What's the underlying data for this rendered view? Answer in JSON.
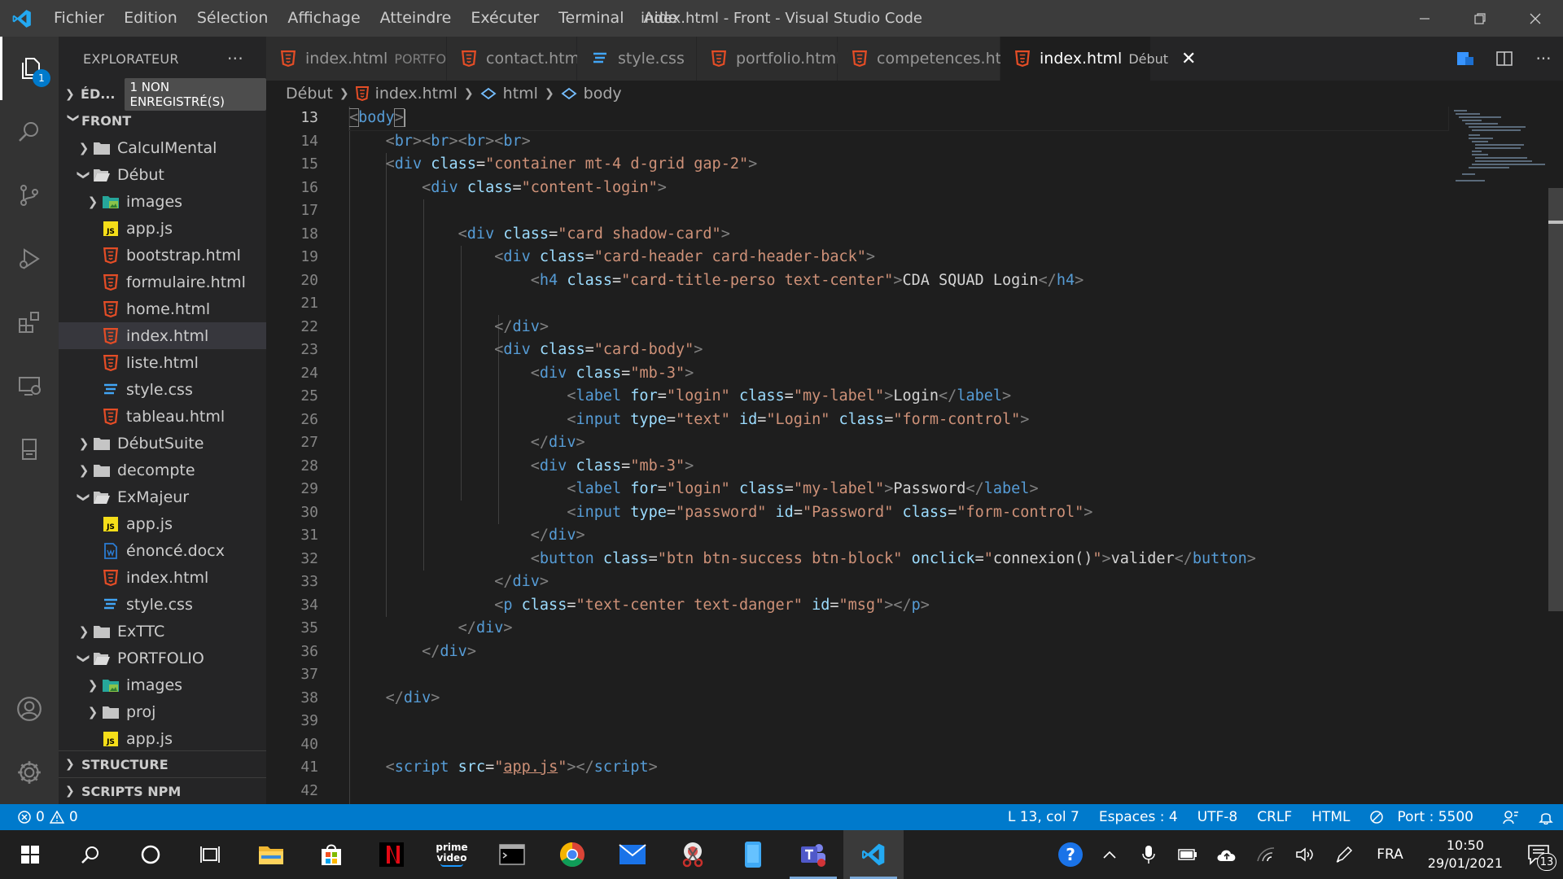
{
  "titlebar": {
    "menu": [
      "Fichier",
      "Edition",
      "Sélection",
      "Affichage",
      "Atteindre",
      "Exécuter",
      "Terminal",
      "Aide"
    ],
    "title": "index.html - Front - Visual Studio Code"
  },
  "activitybar": {
    "explorer_badge": "1"
  },
  "sidebar": {
    "header": "EXPLORATEUR",
    "more": "···",
    "open_editors": {
      "label": "ÉD...",
      "unsaved": "1 NON ENREGISTRÉ(S)"
    },
    "workspace": "FRONT",
    "tree": [
      {
        "label": "CalculMental",
        "type": "folder",
        "open": false,
        "depth": 0
      },
      {
        "label": "Début",
        "type": "folder",
        "open": true,
        "depth": 0
      },
      {
        "label": "images",
        "type": "img-folder",
        "open": false,
        "depth": 1
      },
      {
        "label": "app.js",
        "type": "js",
        "depth": 1
      },
      {
        "label": "bootstrap.html",
        "type": "html",
        "depth": 1
      },
      {
        "label": "formulaire.html",
        "type": "html",
        "depth": 1
      },
      {
        "label": "home.html",
        "type": "html",
        "depth": 1
      },
      {
        "label": "index.html",
        "type": "html",
        "depth": 1,
        "selected": true
      },
      {
        "label": "liste.html",
        "type": "html",
        "depth": 1
      },
      {
        "label": "style.css",
        "type": "css",
        "depth": 1
      },
      {
        "label": "tableau.html",
        "type": "html",
        "depth": 1
      },
      {
        "label": "DébutSuite",
        "type": "folder",
        "open": false,
        "depth": 0
      },
      {
        "label": "decompte",
        "type": "folder",
        "open": false,
        "depth": 0
      },
      {
        "label": "ExMajeur",
        "type": "folder",
        "open": true,
        "depth": 0
      },
      {
        "label": "app.js",
        "type": "js",
        "depth": 1
      },
      {
        "label": "énoncé.docx",
        "type": "docx",
        "depth": 1
      },
      {
        "label": "index.html",
        "type": "html",
        "depth": 1
      },
      {
        "label": "style.css",
        "type": "css",
        "depth": 1
      },
      {
        "label": "ExTTC",
        "type": "folder",
        "open": false,
        "depth": 0
      },
      {
        "label": "PORTFOLIO",
        "type": "folder",
        "open": true,
        "depth": 0
      },
      {
        "label": "images",
        "type": "img-folder",
        "open": false,
        "depth": 1
      },
      {
        "label": "proj",
        "type": "folder",
        "open": false,
        "depth": 1
      },
      {
        "label": "app.js",
        "type": "js",
        "depth": 1
      }
    ],
    "structure": "STRUCTURE",
    "npm": "SCRIPTS NPM"
  },
  "tabs": [
    {
      "label": "index.html",
      "desc": "PORTFOLIO",
      "type": "html"
    },
    {
      "label": "contact.html",
      "desc": "",
      "type": "html"
    },
    {
      "label": "style.css",
      "desc": "",
      "type": "css"
    },
    {
      "label": "portfolio.html",
      "desc": "",
      "type": "html",
      "dirty": true
    },
    {
      "label": "competences.html",
      "desc": "",
      "type": "html"
    },
    {
      "label": "index.html",
      "desc": "Début",
      "type": "html",
      "active": true
    }
  ],
  "breadcrumb": [
    "Début",
    "index.html",
    "html",
    "body"
  ],
  "editor": {
    "line_numbers": [
      "13",
      "14",
      "15",
      "16",
      "17",
      "18",
      "19",
      "20",
      "21",
      "22",
      "23",
      "24",
      "25",
      "26",
      "27",
      "28",
      "29",
      "30",
      "31",
      "32",
      "33",
      "34",
      "35",
      "36",
      "37",
      "38",
      "39",
      "40",
      "41",
      "42"
    ],
    "current_line": "13"
  },
  "statusbar": {
    "errors": "0",
    "warnings": "0",
    "position": "L 13, col 7",
    "spaces": "Espaces : 4",
    "encoding": "UTF-8",
    "eol": "CRLF",
    "language": "HTML",
    "port": "Port : 5500"
  },
  "taskbar": {
    "lang": "FRA",
    "time": "10:50",
    "date": "29/01/2021",
    "notif_count": "13",
    "prime_label_1": "prime",
    "prime_label_2": "video"
  },
  "colors": {
    "accent": "#007acc",
    "html_icon": "#e44d26",
    "css_icon": "#42a5f5",
    "js_icon": "#f5de19"
  }
}
